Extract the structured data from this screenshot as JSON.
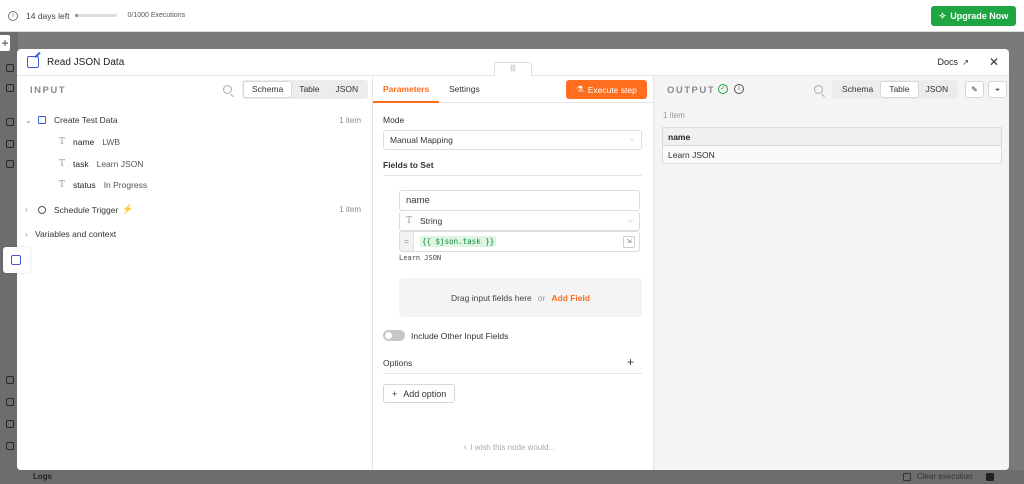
{
  "banner": {
    "days_left": "14 days left",
    "executions": "0/1000 Executions",
    "upgrade_label": "Upgrade Now",
    "trial_progress_fraction": 0.05
  },
  "background": {
    "logs_label": "Logs",
    "clear_label": "Clear execution"
  },
  "modal": {
    "title": "Read JSON Data",
    "docs_label": "Docs",
    "drag_handle": "|||"
  },
  "input": {
    "label": "INPUT",
    "views": [
      "Schema",
      "Table",
      "JSON"
    ],
    "active_view": "Schema",
    "nodes": [
      {
        "name": "Create Test Data",
        "count": "1 item",
        "fields": [
          {
            "key": "name",
            "value": "LWB"
          },
          {
            "key": "task",
            "value": "Learn JSON"
          },
          {
            "key": "status",
            "value": "In Progress"
          }
        ]
      },
      {
        "name": "Schedule Trigger",
        "count": "1 item"
      }
    ],
    "variables_label": "Variables and context"
  },
  "params": {
    "tabs": [
      "Parameters",
      "Settings"
    ],
    "active_tab": "Parameters",
    "execute_label": "Execute step",
    "mode_label": "Mode",
    "mode_value": "Manual Mapping",
    "fields_to_set_label": "Fields to Set",
    "field_name": "name",
    "field_type": "String",
    "field_expression": "{{ $json.task }}",
    "field_expression_result": "Learn JSON",
    "drop_text": "Drag input fields here",
    "drop_or": "or",
    "drop_add": "Add Field",
    "include_other_label": "Include Other Input Fields",
    "include_other_enabled": false,
    "options_label": "Options",
    "add_option_label": "Add option",
    "wish_label": "I wish this node would..."
  },
  "output": {
    "label": "OUTPUT",
    "views": [
      "Schema",
      "Table",
      "JSON"
    ],
    "active_view": "Table",
    "item_count": "1 item",
    "table": {
      "headers": [
        "name"
      ],
      "rows": [
        [
          "Learn JSON"
        ]
      ]
    }
  },
  "colors": {
    "accent": "#ff6d1f",
    "success": "#1fa642",
    "node_blue": "#3f5bd6"
  }
}
